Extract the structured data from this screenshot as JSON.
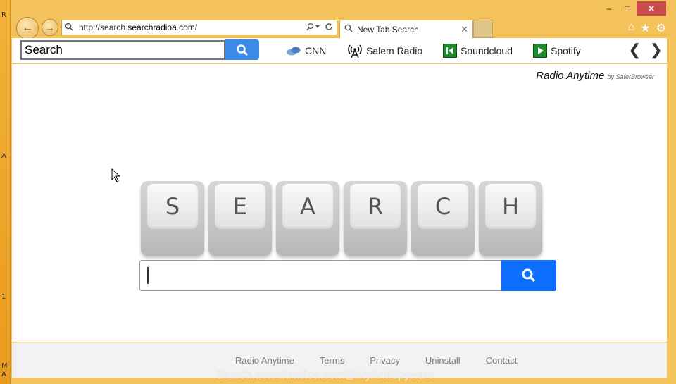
{
  "desktop": {
    "edge_letters": [
      "R",
      "A",
      "1",
      "M",
      "A"
    ]
  },
  "window": {
    "minimize": "–",
    "maximize": "□",
    "close": "✕"
  },
  "address_bar": {
    "url_prefix": "http://search.",
    "url_domain": "searchradioa.com",
    "url_suffix": "/"
  },
  "tab": {
    "label": "New Tab Search"
  },
  "toolbar": {
    "search_value": "Search",
    "bookmarks": [
      {
        "label": "CNN",
        "icon": "cloud-icon"
      },
      {
        "label": "Salem Radio",
        "icon": "antenna-icon"
      },
      {
        "label": "Soundcloud",
        "icon": "skip-back-icon"
      },
      {
        "label": "Spotify",
        "icon": "play-icon"
      }
    ]
  },
  "brand": {
    "name": "Radio Anytime",
    "by": "by SaferBrowser"
  },
  "keys": [
    "S",
    "E",
    "A",
    "R",
    "C",
    "H"
  ],
  "footer": {
    "links": [
      "Radio Anytime",
      "Terms",
      "Privacy",
      "Uninstall",
      "Contact"
    ],
    "watermark": "Search.searchradioa.com@MyAntiSpyware"
  },
  "colors": {
    "accent": "#0d6efd",
    "toolbar_button": "#3c8ae8",
    "frame": "#f4c25a",
    "close": "#c94b4b"
  }
}
